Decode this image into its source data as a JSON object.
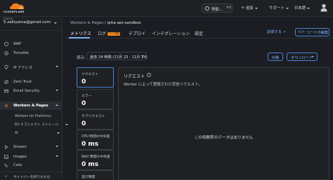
{
  "brand": {
    "wordmark": "CLOUDFLARE",
    "accent": "#f38020"
  },
  "topbar": {
    "search_label": "移動...",
    "search_shortcut": "⌘K",
    "add_label": "追加",
    "support_label": "サポート",
    "language_label": "日本語"
  },
  "sidebar": {
    "account": "5.zakiyama@gmail.com",
    "items": [
      {
        "label": "WAF"
      },
      {
        "label": "Turnstile"
      },
      {
        "label": "IP アドレス"
      },
      {
        "label": "Zero Trust"
      },
      {
        "label": "Email Security"
      },
      {
        "label": "Workers & Pages"
      },
      {
        "label": "Stream"
      },
      {
        "label": "Images"
      },
      {
        "label": "Calls"
      }
    ],
    "subitems": [
      {
        "label": "Workers for Platforms"
      },
      {
        "label": "R2 オブジェクト ストレージ"
      },
      {
        "label": "AI"
      }
    ],
    "collapse_label": "サイドバーを折りたたむ"
  },
  "breadcrumb": {
    "parent": "Workers & Pages",
    "separator": "/",
    "current": "qiita-api-sandbox"
  },
  "tabs": [
    {
      "label": "メトリクス"
    },
    {
      "label": "ログ"
    },
    {
      "label": "デプロイ"
    },
    {
      "label": "インテグレーション"
    },
    {
      "label": "設定"
    }
  ],
  "beta_badge": "ベータ版",
  "header_actions": {
    "visit_label": "訪問する",
    "edit_code_label": "コードの編集"
  },
  "filter": {
    "label": "表示:",
    "range": "過去 24 時間 (11月 23 - 11月 24)",
    "print_label": "印刷",
    "download_label": "ダウンロード"
  },
  "metrics": [
    {
      "label": "リクエスト",
      "value": "0"
    },
    {
      "label": "エラー",
      "value": "0"
    },
    {
      "label": "サブリクエスト",
      "value": "0"
    },
    {
      "label": "CPU 時間の中央値",
      "value": "0 ms"
    },
    {
      "label": "Wall 時間の中央値",
      "value": "0 ms"
    },
    {
      "label": "実行時間",
      "value": ""
    }
  ],
  "panel": {
    "title": "リクエスト",
    "subtitle": "Worker によって登録された受信リクエスト。",
    "empty_message": "この時間帯のデータはありません"
  }
}
